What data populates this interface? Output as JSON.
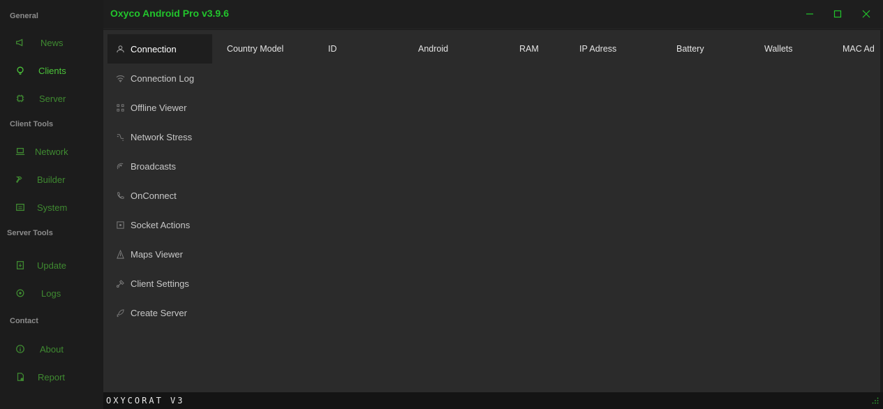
{
  "window": {
    "title": "Oxyco Android Pro v3.9.6",
    "footer_brand": "OXYCORAT V3",
    "accent": "#22c52c"
  },
  "rail": {
    "sections": [
      {
        "label": "General"
      },
      {
        "label": "Client Tools"
      },
      {
        "label": "Server Tools"
      },
      {
        "label": "Contact"
      }
    ],
    "items": [
      {
        "label": "News",
        "icon": "megaphone-icon"
      },
      {
        "label": "Clients",
        "icon": "lightbulb-icon"
      },
      {
        "label": "Server",
        "icon": "chip-icon"
      },
      {
        "label": "Network",
        "icon": "laptop-icon"
      },
      {
        "label": "Builder",
        "icon": "hammer-icon"
      },
      {
        "label": "System",
        "icon": "system-icon"
      },
      {
        "label": "Update",
        "icon": "update-icon"
      },
      {
        "label": "Logs",
        "icon": "logs-icon"
      },
      {
        "label": "About",
        "icon": "info-icon"
      },
      {
        "label": "Report",
        "icon": "report-icon"
      }
    ]
  },
  "submenu": {
    "items": [
      {
        "label": "Connection",
        "icon": "user-icon"
      },
      {
        "label": "Connection Log",
        "icon": "wifi-icon"
      },
      {
        "label": "Offline Viewer",
        "icon": "grid-icon"
      },
      {
        "label": "Network Stress",
        "icon": "stress-icon"
      },
      {
        "label": "Broadcasts",
        "icon": "broadcast-icon"
      },
      {
        "label": "OnConnect",
        "icon": "phone-icon"
      },
      {
        "label": "Socket Actions",
        "icon": "socket-icon"
      },
      {
        "label": "Maps Viewer",
        "icon": "map-icon"
      },
      {
        "label": "Client Settings",
        "icon": "settings-icon"
      },
      {
        "label": "Create Server",
        "icon": "rocket-icon"
      }
    ]
  },
  "table": {
    "columns": [
      "Country Model",
      "ID",
      "Android",
      "RAM",
      "IP Adress",
      "Battery",
      "Wallets",
      "MAC Ad"
    ]
  }
}
